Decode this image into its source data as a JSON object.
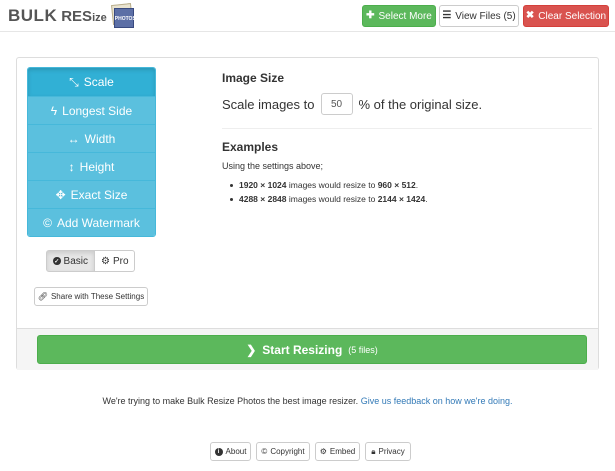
{
  "header": {
    "logo_bulk": "BULK",
    "logo_re": "RES",
    "logo_ize": "ize",
    "logo_photos": "PHOTOS",
    "select_more_label": "Select More",
    "view_files_label": "View Files (5)",
    "clear_selection_label": "Clear Selection",
    "colors": {
      "success": "#5cb85c",
      "danger": "#d9534f",
      "info": "#5bc0de"
    }
  },
  "sidebar": {
    "items": [
      {
        "label": "Scale",
        "icon": "compress-arrows-icon",
        "glyph": "⤡",
        "active": true
      },
      {
        "label": "Longest Side",
        "icon": "bolt-icon",
        "glyph": "ϟ",
        "active": false
      },
      {
        "label": "Width",
        "icon": "horizontal-arrows-icon",
        "glyph": "↔",
        "active": false
      },
      {
        "label": "Height",
        "icon": "vertical-arrows-icon",
        "glyph": "↕",
        "active": false
      },
      {
        "label": "Exact Size",
        "icon": "move-arrows-icon",
        "glyph": "✥",
        "active": false
      },
      {
        "label": "Add Watermark",
        "icon": "copyright-circle-icon",
        "glyph": "©",
        "active": false
      }
    ],
    "mode_basic": "Basic",
    "mode_pro": "Pro",
    "share_label": "Share with These Settings"
  },
  "main": {
    "image_size_title": "Image Size",
    "scale_prefix": "Scale images to",
    "scale_value": "50",
    "scale_suffix": "% of the original size.",
    "examples_title": "Examples",
    "examples_intro": "Using the settings above;",
    "examples": [
      {
        "from": "1920 × 1024",
        "middle": " images would resize to ",
        "to": "960 × 512",
        "end": "."
      },
      {
        "from": "4288 × 2848",
        "middle": " images would resize to ",
        "to": "2144 × 1424",
        "end": "."
      }
    ],
    "start_label": "Start Resizing",
    "start_sub": "(5 files)"
  },
  "feedback": {
    "text": "We're trying to make Bulk Resize Photos the best image resizer.",
    "link": "Give us feedback on how we're doing."
  },
  "footer": {
    "about": "About",
    "copyright": "Copyright",
    "embed": "Embed",
    "privacy": "Privacy"
  }
}
